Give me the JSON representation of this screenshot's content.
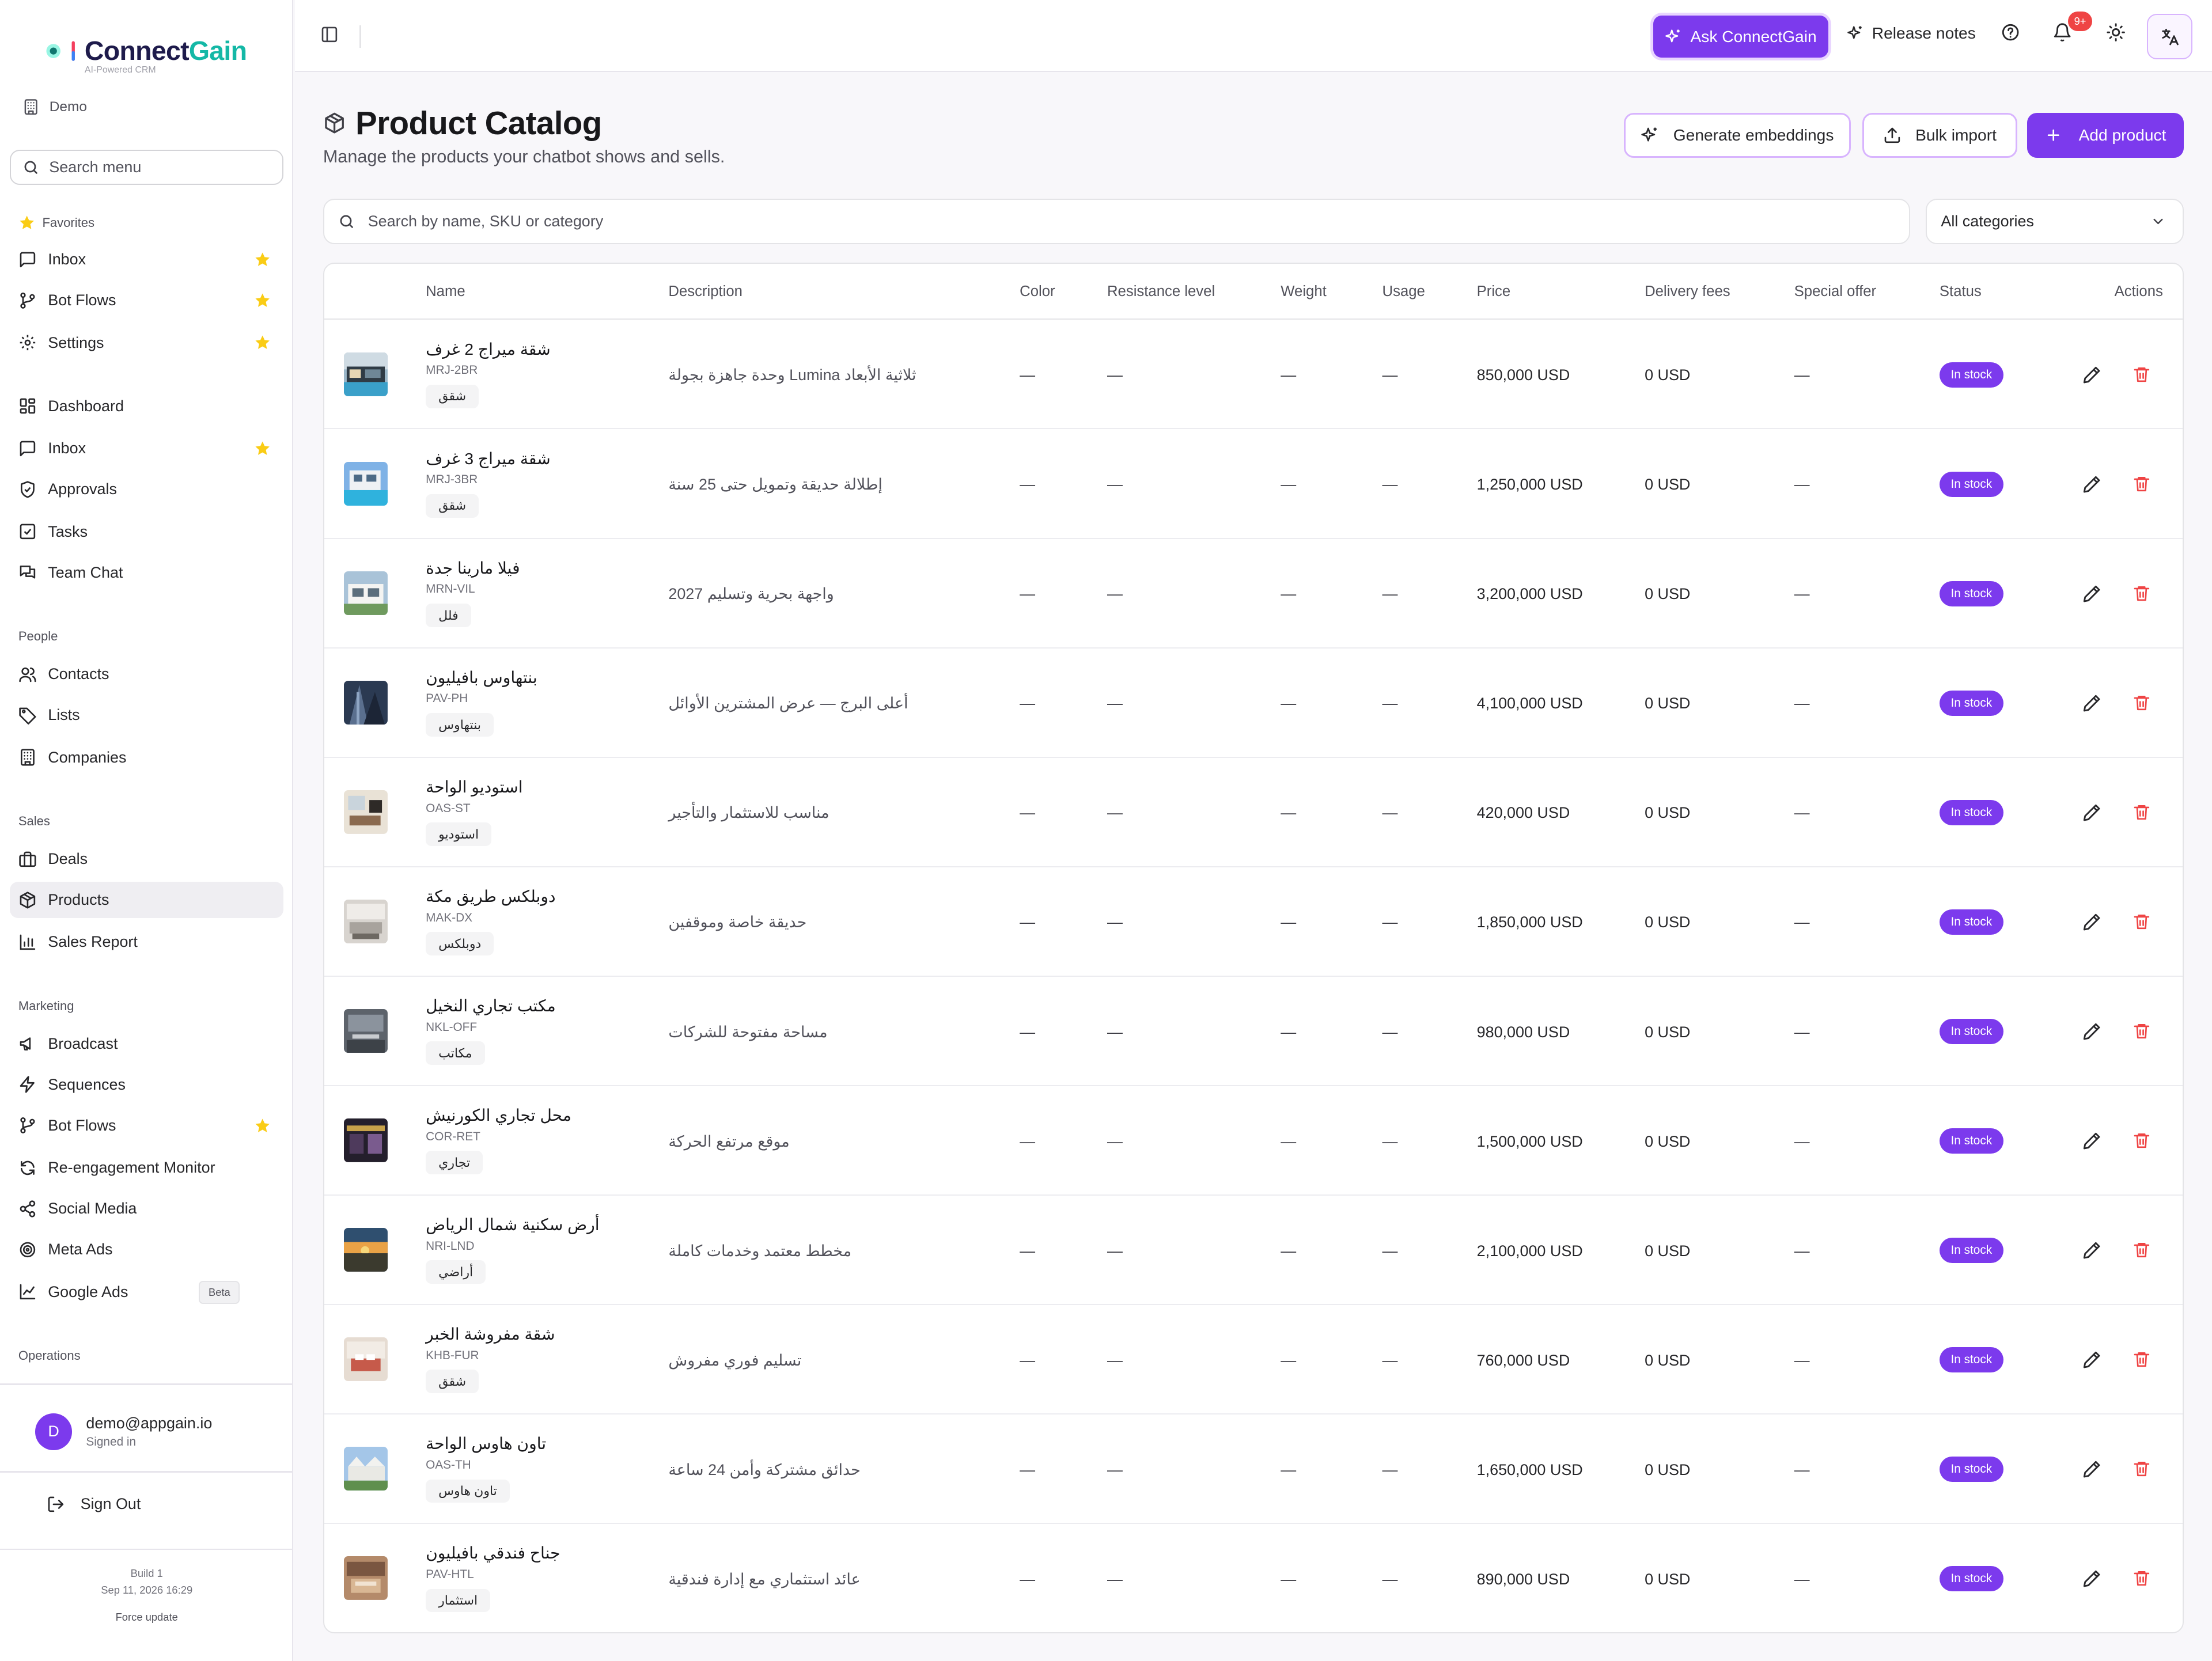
{
  "app": {
    "brand_part1": "Connect",
    "brand_part2": "Gain",
    "tagline": "AI-Powered CRM",
    "workspace": "Demo"
  },
  "colors": {
    "accent": "#7c3aed",
    "brand_teal": "#14b8a6",
    "star": "#facc15",
    "danger": "#ef4444"
  },
  "sidebar": {
    "search_placeholder": "Search menu",
    "favorites_label": "Favorites",
    "favorites": [
      {
        "label": "Inbox",
        "icon": "message-square-icon"
      },
      {
        "label": "Bot Flows",
        "icon": "git-branch-icon"
      },
      {
        "label": "Settings",
        "icon": "gear-icon"
      }
    ],
    "main": [
      {
        "label": "Dashboard",
        "icon": "layout-grid-icon"
      },
      {
        "label": "Inbox",
        "icon": "message-square-icon",
        "starred": true
      },
      {
        "label": "Approvals",
        "icon": "shield-check-icon"
      },
      {
        "label": "Tasks",
        "icon": "checkbox-icon"
      },
      {
        "label": "Team Chat",
        "icon": "chat-bubbles-icon"
      }
    ],
    "people_label": "People",
    "people": [
      {
        "label": "Contacts",
        "icon": "users-icon"
      },
      {
        "label": "Lists",
        "icon": "tag-icon"
      },
      {
        "label": "Companies",
        "icon": "building-icon"
      }
    ],
    "sales_label": "Sales",
    "sales": [
      {
        "label": "Deals",
        "icon": "briefcase-icon"
      },
      {
        "label": "Products",
        "icon": "package-icon",
        "active": true
      },
      {
        "label": "Sales Report",
        "icon": "bar-chart-icon"
      }
    ],
    "marketing_label": "Marketing",
    "marketing": [
      {
        "label": "Broadcast",
        "icon": "megaphone-icon"
      },
      {
        "label": "Sequences",
        "icon": "zap-icon"
      },
      {
        "label": "Bot Flows",
        "icon": "git-branch-icon",
        "starred": true
      },
      {
        "label": "Re-engagement Monitor",
        "icon": "refresh-icon"
      },
      {
        "label": "Social Media",
        "icon": "share-icon"
      },
      {
        "label": "Meta Ads",
        "icon": "target-icon"
      },
      {
        "label": "Google Ads",
        "icon": "line-chart-icon",
        "badge": "Beta"
      }
    ],
    "operations_label": "Operations",
    "user": {
      "initial": "D",
      "email": "demo@appgain.io",
      "status": "Signed in"
    },
    "sign_out": "Sign Out",
    "build_label": "Build 1",
    "build_date": "Sep 11, 2026 16:29",
    "force_update": "Force update"
  },
  "topbar": {
    "ask_label": "Ask ConnectGain",
    "release_label": "Release notes",
    "notif_count": "9+"
  },
  "page": {
    "title": "Product Catalog",
    "subtitle": "Manage the products your chatbot shows and sells.",
    "generate_label": "Generate embeddings",
    "bulk_label": "Bulk import",
    "add_label": "Add product",
    "search_placeholder": "Search by name, SKU or category",
    "category_select": "All categories"
  },
  "table": {
    "columns": {
      "name": "Name",
      "description": "Description",
      "color": "Color",
      "resistance": "Resistance level",
      "weight": "Weight",
      "usage": "Usage",
      "price": "Price",
      "delivery": "Delivery fees",
      "offer": "Special offer",
      "status": "Status",
      "actions": "Actions"
    },
    "rows": [
      {
        "name": "شقة ميراج 2 غرف",
        "sku": "MRJ-2BR",
        "category": "شقق",
        "description": "ثلاثية الأبعاد Lumina وحدة جاهزة بجولة",
        "color": "—",
        "resistance": "—",
        "weight": "—",
        "usage": "—",
        "price": "850,000 USD",
        "delivery": "0 USD",
        "offer": "—",
        "status": "In stock",
        "thumb": "villa-pool"
      },
      {
        "name": "شقة ميراج 3 غرف",
        "sku": "MRJ-3BR",
        "category": "شقق",
        "description": "إطلالة حديقة وتمويل حتى 25 سنة",
        "color": "—",
        "resistance": "—",
        "weight": "—",
        "usage": "—",
        "price": "1,250,000 USD",
        "delivery": "0 USD",
        "offer": "—",
        "status": "In stock",
        "thumb": "pool-day"
      },
      {
        "name": "فيلا مارينا جدة",
        "sku": "MRN-VIL",
        "category": "فلل",
        "description": "واجهة بحرية وتسليم 2027",
        "color": "—",
        "resistance": "—",
        "weight": "—",
        "usage": "—",
        "price": "3,200,000 USD",
        "delivery": "0 USD",
        "offer": "—",
        "status": "In stock",
        "thumb": "villa-white"
      },
      {
        "name": "بنتهاوس بافيليون",
        "sku": "PAV-PH",
        "category": "بنتهاوس",
        "description": "أعلى البرج — عرض المشترين الأوائل",
        "color": "—",
        "resistance": "—",
        "weight": "—",
        "usage": "—",
        "price": "4,100,000 USD",
        "delivery": "0 USD",
        "offer": "—",
        "status": "In stock",
        "thumb": "tower"
      },
      {
        "name": "استوديو الواحة",
        "sku": "OAS-ST",
        "category": "استوديو",
        "description": "مناسب للاستثمار والتأجير",
        "color": "—",
        "resistance": "—",
        "weight": "—",
        "usage": "—",
        "price": "420,000 USD",
        "delivery": "0 USD",
        "offer": "—",
        "status": "In stock",
        "thumb": "studio"
      },
      {
        "name": "دوبلكس طريق مكة",
        "sku": "MAK-DX",
        "category": "دوبلكس",
        "description": "حديقة خاصة وموقفين",
        "color": "—",
        "resistance": "—",
        "weight": "—",
        "usage": "—",
        "price": "1,850,000 USD",
        "delivery": "0 USD",
        "offer": "—",
        "status": "In stock",
        "thumb": "living"
      },
      {
        "name": "مكتب تجاري النخيل",
        "sku": "NKL-OFF",
        "category": "مكاتب",
        "description": "مساحة مفتوحة للشركات",
        "color": "—",
        "resistance": "—",
        "weight": "—",
        "usage": "—",
        "price": "980,000 USD",
        "delivery": "0 USD",
        "offer": "—",
        "status": "In stock",
        "thumb": "office"
      },
      {
        "name": "محل تجاري الكورنيش",
        "sku": "COR-RET",
        "category": "تجاري",
        "description": "موقع مرتفع الحركة",
        "color": "—",
        "resistance": "—",
        "weight": "—",
        "usage": "—",
        "price": "1,500,000 USD",
        "delivery": "0 USD",
        "offer": "—",
        "status": "In stock",
        "thumb": "shop"
      },
      {
        "name": "أرض سكنية شمال الرياض",
        "sku": "NRI-LND",
        "category": "أراضي",
        "description": "مخطط معتمد وخدمات كاملة",
        "color": "—",
        "resistance": "—",
        "weight": "—",
        "usage": "—",
        "price": "2,100,000 USD",
        "delivery": "0 USD",
        "offer": "—",
        "status": "In stock",
        "thumb": "sunset"
      },
      {
        "name": "شقة مفروشة الخبر",
        "sku": "KHB-FUR",
        "category": "شقق",
        "description": "تسليم فوري مفروش",
        "color": "—",
        "resistance": "—",
        "weight": "—",
        "usage": "—",
        "price": "760,000 USD",
        "delivery": "0 USD",
        "offer": "—",
        "status": "In stock",
        "thumb": "bedroom"
      },
      {
        "name": "تاون هاوس الواحة",
        "sku": "OAS-TH",
        "category": "تاون هاوس",
        "description": "حدائق مشتركة وأمن 24 ساعة",
        "color": "—",
        "resistance": "—",
        "weight": "—",
        "usage": "—",
        "price": "1,650,000 USD",
        "delivery": "0 USD",
        "offer": "—",
        "status": "In stock",
        "thumb": "townhouse"
      },
      {
        "name": "جناح فندقي بافيليون",
        "sku": "PAV-HTL",
        "category": "استثمار",
        "description": "عائد استثماري مع إدارة فندقية",
        "color": "—",
        "resistance": "—",
        "weight": "—",
        "usage": "—",
        "price": "890,000 USD",
        "delivery": "0 USD",
        "offer": "—",
        "status": "In stock",
        "thumb": "hotel"
      }
    ]
  }
}
